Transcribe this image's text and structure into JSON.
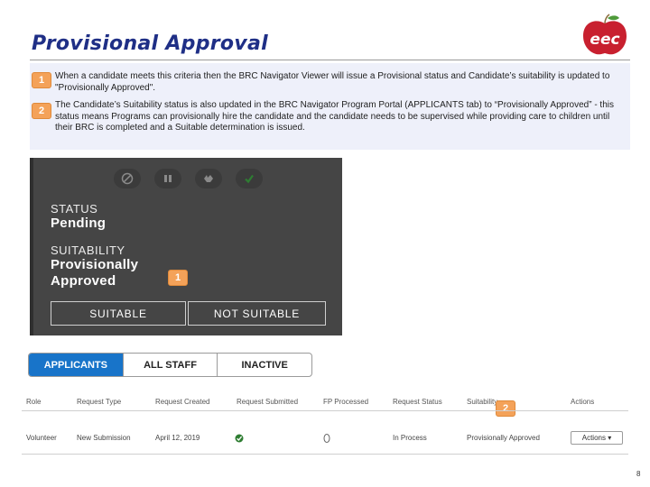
{
  "slide": {
    "title": "Provisional Approval",
    "page_number": "8"
  },
  "logo": {
    "text": "eec",
    "color": "#c8202f"
  },
  "notes": [
    {
      "badge": "1",
      "text": "When a candidate meets this criteria then the BRC Navigator Viewer will issue a Provisional status and Candidate’s suitability is updated to \"Provisionally Approved\"."
    },
    {
      "badge": "2",
      "text": "The Candidate’s Suitability status is also updated in the BRC Navigator Program Portal (APPLICANTS tab) to “Provisionally Approved” - this status means Programs can provisionally hire the candidate and the candidate needs to be supervised while providing care to children until their BRC is completed and a Suitable determination is issued."
    }
  ],
  "status_panel": {
    "toolbar_icons": [
      "ban-icon",
      "pause-icon",
      "thumbs-icon",
      "check-icon"
    ],
    "status_label": "STATUS",
    "status_value": "Pending",
    "suitability_label": "SUITABILITY",
    "suitability_line1": "Provisionally",
    "suitability_line2": "Approved",
    "badge": "1",
    "suitable_button": "SUITABLE",
    "not_suitable_button": "NOT SUITABLE"
  },
  "tabs": [
    {
      "label": "APPLICANTS",
      "active": true
    },
    {
      "label": "ALL STAFF",
      "active": false
    },
    {
      "label": "INACTIVE",
      "active": false
    }
  ],
  "table": {
    "columns": [
      "Role",
      "Request Type",
      "Request Created",
      "Request Submitted",
      "FP Processed",
      "Request Status",
      "Suitability",
      "Actions"
    ],
    "badge": "2",
    "row": {
      "role": "Volunteer",
      "request_type": "New Submission",
      "request_created": "April 12, 2019",
      "request_status": "In Process",
      "suitability": "Provisionally Approved",
      "actions_button": "Actions ▾"
    }
  },
  "colors": {
    "title": "#1f2f86",
    "badge": "#f4a259",
    "active_tab": "#1874c9",
    "panel": "#454545",
    "check_green": "#2e7d32"
  }
}
